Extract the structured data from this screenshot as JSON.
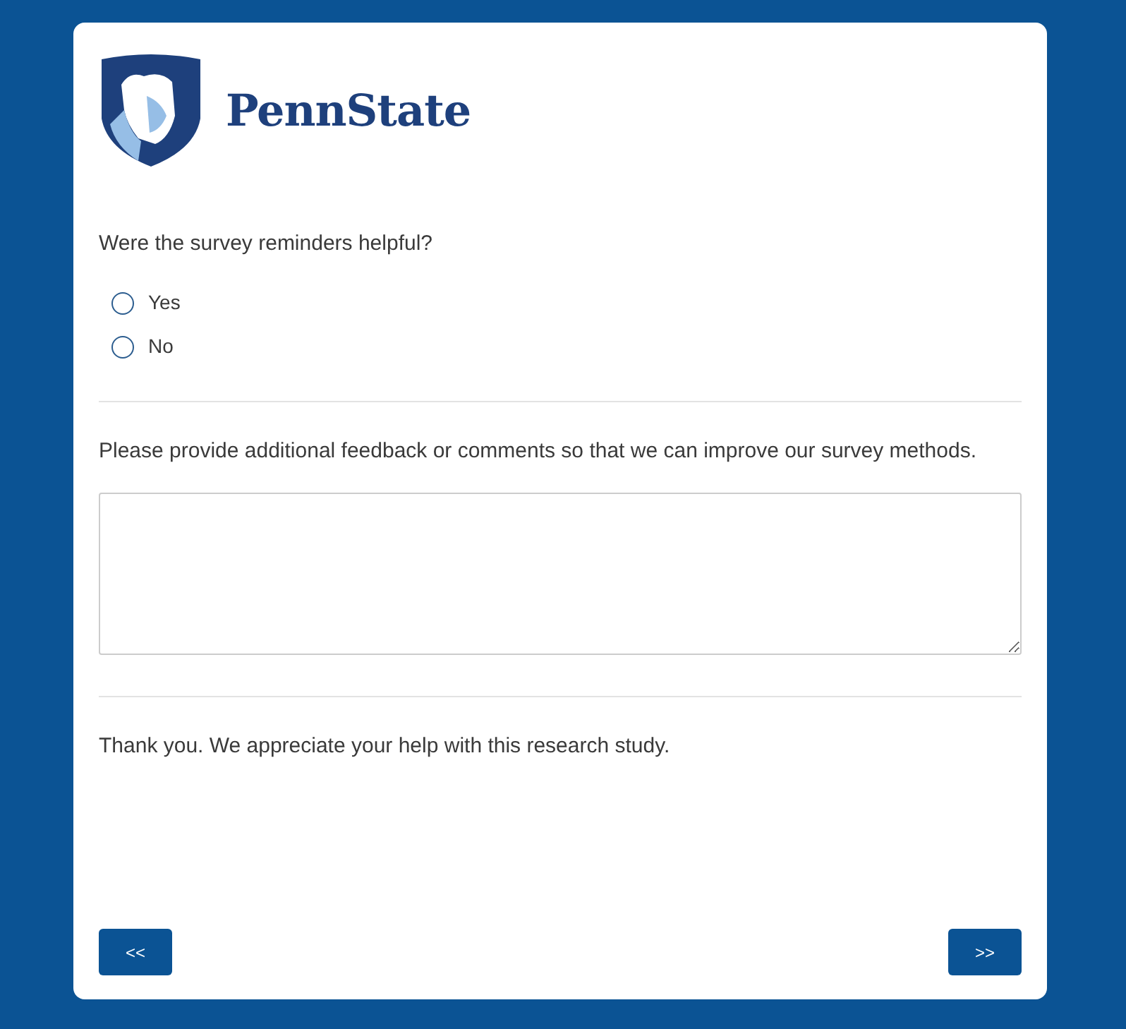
{
  "logo": {
    "wordmark": "PennState"
  },
  "questions": [
    {
      "kind": "radio",
      "text": "Were the survey reminders helpful?",
      "options": [
        {
          "label": "Yes",
          "selected": false
        },
        {
          "label": "No",
          "selected": false
        }
      ]
    },
    {
      "kind": "textarea",
      "text": "Please provide additional feedback or comments so that we can improve our survey methods."
    },
    {
      "kind": "text",
      "text": "Thank you. We appreciate your help with this research study."
    }
  ],
  "buttons": {
    "back": "<<",
    "next": ">>"
  }
}
